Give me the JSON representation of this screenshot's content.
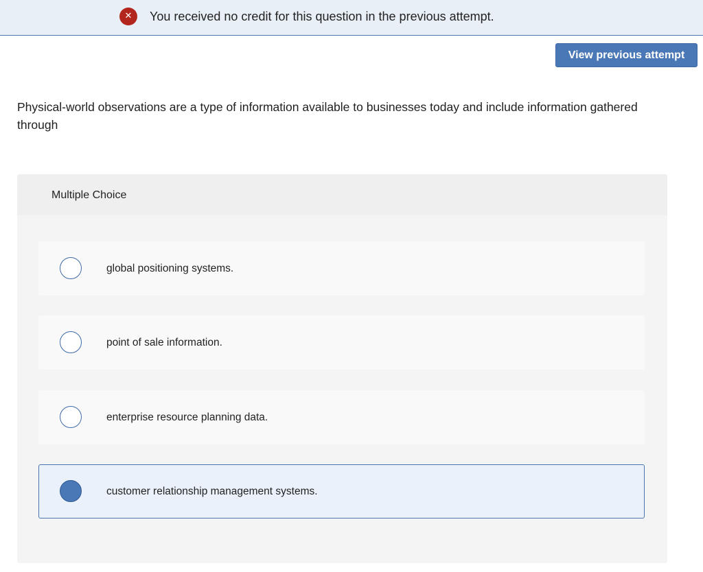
{
  "banner": {
    "icon": "x-circle-icon",
    "icon_glyph": "✕",
    "message": "You received no credit for this question in the previous attempt."
  },
  "toolbar": {
    "view_previous_label": "View previous attempt"
  },
  "question": {
    "text": "Physical-world observations are a type of information available to businesses today and include information gathered through"
  },
  "multiple_choice": {
    "header": "Multiple Choice",
    "options": [
      {
        "label": "global positioning systems.",
        "selected": false
      },
      {
        "label": "point of sale information.",
        "selected": false
      },
      {
        "label": "enterprise resource planning data.",
        "selected": false
      },
      {
        "label": "customer relationship management systems.",
        "selected": true
      }
    ]
  },
  "colors": {
    "accent": "#4a77b5",
    "error": "#b3261e",
    "banner_bg": "#e9eff7",
    "panel_bg": "#f4f4f4"
  }
}
